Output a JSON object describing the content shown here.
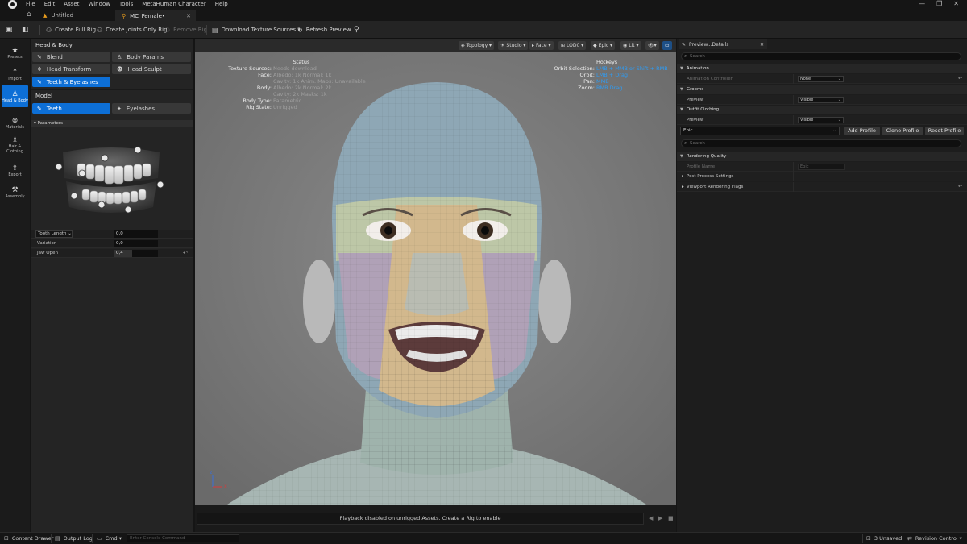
{
  "menu": [
    "File",
    "Edit",
    "Asset",
    "Window",
    "Tools",
    "MetaHuman Character",
    "Help"
  ],
  "window_controls": [
    "—",
    "❐",
    "✕"
  ],
  "tabs": [
    {
      "label": "Untitled",
      "close": ""
    },
    {
      "label": "MC_Female•",
      "close": "✕"
    }
  ],
  "toolbar": {
    "create_full_rig": "Create Full Rig",
    "create_joints_only_rig": "Create Joints Only Rig",
    "remove_rig": "Remove Rig",
    "download_texture_sources": "Download Texture Sources ▾",
    "refresh_preview": "Refresh Preview"
  },
  "leftnav": [
    {
      "label": "Presets",
      "icon": "★"
    },
    {
      "label": "Import",
      "icon": "⇡"
    },
    {
      "label": "Head & Body",
      "icon": "♙"
    },
    {
      "label": "Materials",
      "icon": "⊗"
    },
    {
      "label": "Hair & Clothing",
      "icon": "♗"
    },
    {
      "label": "Export",
      "icon": "⇪"
    },
    {
      "label": "Assembly",
      "icon": "⚒"
    }
  ],
  "left_panel": {
    "header": "Head & Body",
    "buttons": [
      "Blend",
      "Body Params",
      "Head Transform",
      "Head Sculpt",
      "Teeth & Eyelashes"
    ],
    "model_header": "Model",
    "model_buttons": [
      "Teeth",
      "Eyelashes"
    ],
    "parameters_header": "Parameters",
    "params": [
      {
        "label": "Tooth Length",
        "value": "0,0",
        "fill": 0.0
      },
      {
        "label": "Variation",
        "value": "0,0",
        "fill": 0.0
      },
      {
        "label": "Jaw Open",
        "value": "0,4",
        "fill": 0.4
      }
    ],
    "reset_icon": "↶"
  },
  "viewport_toolbar": {
    "topology": "Topology ▾",
    "studio": "Studio ▾",
    "face": "Face ▾",
    "lod": "LOD0 ▾",
    "epic": "Epic ▾",
    "lit": "Lit ▾",
    "view": "👁▾",
    "camera": "▭"
  },
  "viewport_overlay": {
    "status_title": "Status",
    "status_rows": [
      {
        "k": "Texture Sources:",
        "v": "Needs download"
      },
      {
        "k": "Face:",
        "v": "Albedo: 1k Normal: 1k"
      },
      {
        "k": "",
        "v": "Cavity: 1k Anim. Maps: Unavailable"
      },
      {
        "k": "Body:",
        "v": "Albedo: 2k Normal: 2k"
      },
      {
        "k": "",
        "v": "Cavity: 2k Masks: 1k"
      },
      {
        "k": "Body Type:",
        "v": "Parametric"
      },
      {
        "k": "Rig State:",
        "v": "Unrigged"
      }
    ],
    "hotkeys_title": "Hotkeys",
    "hotkeys": [
      {
        "k": "Orbit Selection:",
        "v": "LMB + MMB or Shift + RMB"
      },
      {
        "k": "Orbit:",
        "v": "LMB + Drag"
      },
      {
        "k": "Pan:",
        "v": "MMB"
      },
      {
        "k": "Zoom:",
        "v": "RMB Drag"
      }
    ],
    "axis_z": "z",
    "axis_x": "x"
  },
  "viewport_status": {
    "message": "Playback disabled on unrigged Assets. Create a Rig to enable",
    "controls": [
      "◀",
      "▶",
      "■"
    ]
  },
  "right_panel": {
    "tab_label": "Preview...Details",
    "tab_close": "✕",
    "search_placeholder": "Search",
    "animation_header": "Animation",
    "animation_controller_label": "Animation Controller",
    "animation_controller_value": "None",
    "grooms_header": "Grooms",
    "grooms_preview_label": "Preview",
    "grooms_preview_value": "Visible",
    "outfit_header": "Outfit Clothing",
    "outfit_preview_label": "Preview",
    "outfit_preview_value": "Visible",
    "profile_value": "Epic",
    "add_profile": "Add Profile",
    "clone_profile": "Clone Profile",
    "reset_profile": "Reset Profile",
    "search2_placeholder": "Search",
    "rendering_quality_header": "Rendering Quality",
    "profile_name_label": "Profile Name",
    "profile_name_value": "Epic",
    "post_process_label": "Post Process Settings",
    "viewport_flags_label": "Viewport Rendering Flags"
  },
  "bottom_bar": {
    "content_drawer": "Content Drawer",
    "output_log": "Output Log",
    "cmd": "Cmd ▾",
    "console_placeholder": "Enter Console Command",
    "unsaved": "3 Unsaved",
    "revision_control": "Revision Control ▾"
  },
  "colors": {
    "accent_blue": "#0d6fd6",
    "hotkey_blue": "#2f9bf2",
    "panel_bg": "#242424",
    "viewport_bg": "#7a7a7a"
  }
}
